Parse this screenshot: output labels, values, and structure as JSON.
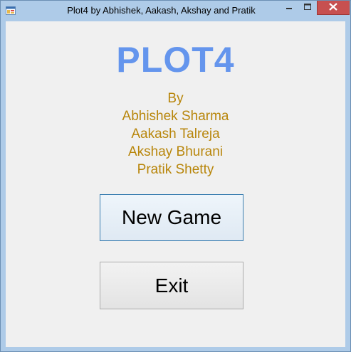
{
  "window": {
    "title": "Plot4 by Abhishek, Aakash, Akshay and Pratik",
    "icon": "app-icon",
    "controls": {
      "minimize_icon": "minimize-icon",
      "maximize_icon": "maximize-icon",
      "close_icon": "close-icon"
    }
  },
  "main": {
    "logo": "PLOT4",
    "credits": {
      "by": "By",
      "authors": [
        "Abhishek Sharma",
        "Aakash Talreja",
        "Akshay Bhurani",
        "Pratik Shetty"
      ]
    },
    "new_game_label": "New Game",
    "exit_label": "Exit"
  },
  "colors": {
    "logo": "#6495ed",
    "credits": "#b8860b",
    "frame": "#aecbe8",
    "close_button": "#c75050",
    "client": "#f0f0f0"
  }
}
